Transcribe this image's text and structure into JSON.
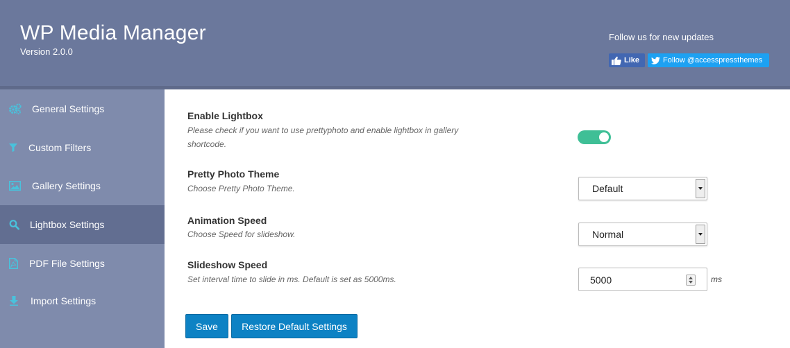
{
  "header": {
    "title": "WP Media Manager",
    "version": "Version 2.0.0",
    "follow_text": "Follow us for new updates",
    "facebook_like": "Like",
    "twitter_follow": "Follow @accesspressthemes"
  },
  "sidebar": {
    "items": [
      {
        "label": "General Settings",
        "icon": "gears-icon",
        "active": false
      },
      {
        "label": "Custom Filters",
        "icon": "filter-icon",
        "active": false
      },
      {
        "label": "Gallery Settings",
        "icon": "image-icon",
        "active": false
      },
      {
        "label": "Lightbox Settings",
        "icon": "search-icon",
        "active": true
      },
      {
        "label": "PDF File Settings",
        "icon": "pdf-file-icon",
        "active": false
      },
      {
        "label": "Import Settings",
        "icon": "import-icon",
        "active": false
      }
    ]
  },
  "settings": {
    "lightbox": {
      "title": "Enable Lightbox",
      "desc_line1": "Please check if you want to use prettyphoto and enable lightbox in gallery",
      "desc_line2": "shortcode.",
      "enabled": true
    },
    "theme": {
      "title": "Pretty Photo Theme",
      "desc": "Choose Pretty Photo Theme.",
      "value": "Default"
    },
    "animation": {
      "title": "Animation Speed",
      "desc": "Choose Speed for slideshow.",
      "value": "Normal"
    },
    "slideshow": {
      "title": "Slideshow Speed",
      "desc": "Set interval time to slide in ms. Default is set as 5000ms.",
      "value": "5000",
      "unit": "ms"
    }
  },
  "buttons": {
    "save": "Save",
    "restore": "Restore Default Settings"
  },
  "colors": {
    "header": "#6b789c",
    "sidebar": "#7f8bac",
    "sidebar_active": "#626e91",
    "toggle_on": "#3fbf96",
    "button": "#0d82c4",
    "icon_accent": "#49c2dc"
  }
}
